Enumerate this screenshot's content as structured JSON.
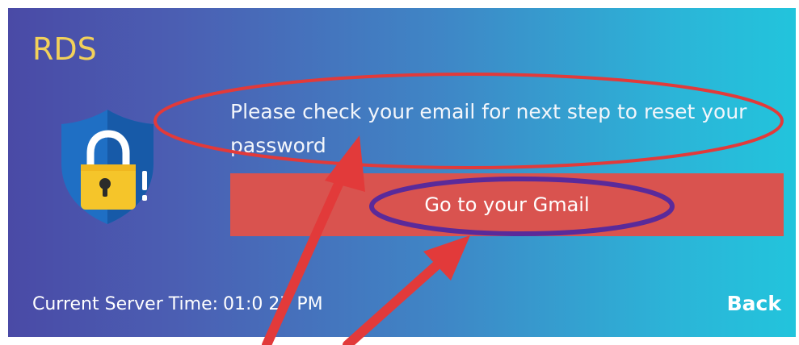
{
  "app": {
    "brand": "RDS"
  },
  "message": {
    "text": "Please check your email for next step to reset your password"
  },
  "actions": {
    "gmail_label": "Go to your Gmail",
    "back_label": "Back"
  },
  "footer": {
    "server_time_label": "Current Server Time:",
    "server_time_value": "01:0 27 PM"
  },
  "icons": {
    "shield": "shield-lock-icon"
  },
  "colors": {
    "brand_text": "#f2d15a",
    "button_bg": "#d9534f",
    "annotation_red": "#e23a3a",
    "annotation_purple": "#5a2a9a"
  }
}
